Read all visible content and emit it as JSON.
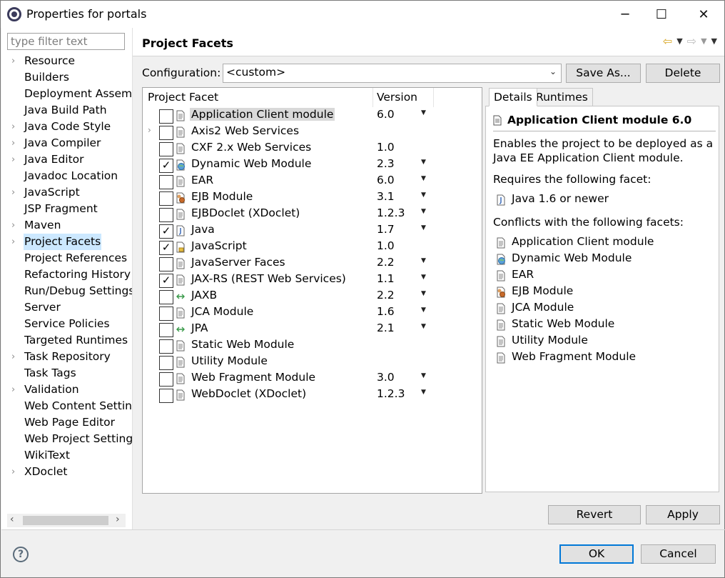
{
  "window": {
    "title": "Properties for portals",
    "minimize": "─",
    "maximize": "☐",
    "close": "✕"
  },
  "sidebar": {
    "filter_placeholder": "type filter text",
    "items": [
      {
        "label": "Resource",
        "expandable": true
      },
      {
        "label": "Builders",
        "expandable": false
      },
      {
        "label": "Deployment Assem",
        "expandable": false
      },
      {
        "label": "Java Build Path",
        "expandable": false
      },
      {
        "label": "Java Code Style",
        "expandable": true
      },
      {
        "label": "Java Compiler",
        "expandable": true
      },
      {
        "label": "Java Editor",
        "expandable": true
      },
      {
        "label": "Javadoc Location",
        "expandable": false
      },
      {
        "label": "JavaScript",
        "expandable": true
      },
      {
        "label": "JSP Fragment",
        "expandable": false
      },
      {
        "label": "Maven",
        "expandable": true
      },
      {
        "label": "Project Facets",
        "expandable": true,
        "selected": true
      },
      {
        "label": "Project References",
        "expandable": false
      },
      {
        "label": "Refactoring History",
        "expandable": false
      },
      {
        "label": "Run/Debug Settings",
        "expandable": false
      },
      {
        "label": "Server",
        "expandable": false
      },
      {
        "label": "Service Policies",
        "expandable": false
      },
      {
        "label": "Targeted Runtimes",
        "expandable": false
      },
      {
        "label": "Task Repository",
        "expandable": true
      },
      {
        "label": "Task Tags",
        "expandable": false
      },
      {
        "label": "Validation",
        "expandable": true
      },
      {
        "label": "Web Content Settin",
        "expandable": false
      },
      {
        "label": "Web Page Editor",
        "expandable": false
      },
      {
        "label": "Web Project Setting",
        "expandable": false
      },
      {
        "label": "WikiText",
        "expandable": false
      },
      {
        "label": "XDoclet",
        "expandable": true
      }
    ]
  },
  "header": {
    "title": "Project Facets"
  },
  "configuration": {
    "label": "Configuration:",
    "value": "<custom>",
    "save_as": "Save As...",
    "delete": "Delete"
  },
  "facets": {
    "col_facet": "Project Facet",
    "col_version": "Version",
    "rows": [
      {
        "name": "Application Client module",
        "version": "6.0",
        "checked": false,
        "dropdown": true,
        "highlight": true,
        "icon": "doc"
      },
      {
        "name": "Axis2 Web Services",
        "version": "",
        "checked": false,
        "dropdown": false,
        "expandable": true,
        "icon": "doc"
      },
      {
        "name": "CXF 2.x Web Services",
        "version": "1.0",
        "checked": false,
        "dropdown": false,
        "icon": "doc"
      },
      {
        "name": "Dynamic Web Module",
        "version": "2.3",
        "checked": true,
        "dropdown": true,
        "icon": "globe"
      },
      {
        "name": "EAR",
        "version": "6.0",
        "checked": false,
        "dropdown": true,
        "icon": "doc"
      },
      {
        "name": "EJB Module",
        "version": "3.1",
        "checked": false,
        "dropdown": true,
        "icon": "bean"
      },
      {
        "name": "EJBDoclet (XDoclet)",
        "version": "1.2.3",
        "checked": false,
        "dropdown": true,
        "icon": "doc"
      },
      {
        "name": "Java",
        "version": "1.7",
        "checked": true,
        "dropdown": true,
        "icon": "java"
      },
      {
        "name": "JavaScript",
        "version": "1.0",
        "checked": true,
        "dropdown": false,
        "icon": "js"
      },
      {
        "name": "JavaServer Faces",
        "version": "2.2",
        "checked": false,
        "dropdown": true,
        "icon": "doc"
      },
      {
        "name": "JAX-RS (REST Web Services)",
        "version": "1.1",
        "checked": true,
        "dropdown": true,
        "icon": "doc"
      },
      {
        "name": "JAXB",
        "version": "2.2",
        "checked": false,
        "dropdown": true,
        "icon": "arrows"
      },
      {
        "name": "JCA Module",
        "version": "1.6",
        "checked": false,
        "dropdown": true,
        "icon": "doc"
      },
      {
        "name": "JPA",
        "version": "2.1",
        "checked": false,
        "dropdown": true,
        "icon": "arrows"
      },
      {
        "name": "Static Web Module",
        "version": "",
        "checked": false,
        "dropdown": false,
        "icon": "doc"
      },
      {
        "name": "Utility Module",
        "version": "",
        "checked": false,
        "dropdown": false,
        "icon": "doc"
      },
      {
        "name": "Web Fragment Module",
        "version": "3.0",
        "checked": false,
        "dropdown": true,
        "icon": "doc"
      },
      {
        "name": "WebDoclet (XDoclet)",
        "version": "1.2.3",
        "checked": false,
        "dropdown": true,
        "icon": "doc"
      }
    ]
  },
  "details": {
    "tab_details": "Details",
    "tab_runtimes": "Runtimes",
    "title": "Application Client module 6.0",
    "desc1": "Enables the project to be deployed as a",
    "desc2": "Java EE Application Client module.",
    "requires_label": "Requires the following facet:",
    "requires": [
      {
        "label": "Java 1.6 or newer",
        "icon": "java"
      }
    ],
    "conflicts_label": "Conflicts with the following facets:",
    "conflicts": [
      {
        "label": "Application Client module",
        "icon": "doc"
      },
      {
        "label": "Dynamic Web Module",
        "icon": "globe"
      },
      {
        "label": "EAR",
        "icon": "doc"
      },
      {
        "label": "EJB Module",
        "icon": "bean"
      },
      {
        "label": "JCA Module",
        "icon": "doc"
      },
      {
        "label": "Static Web Module",
        "icon": "doc"
      },
      {
        "label": "Utility Module",
        "icon": "doc"
      },
      {
        "label": "Web Fragment Module",
        "icon": "doc"
      }
    ]
  },
  "buttons": {
    "revert": "Revert",
    "apply": "Apply",
    "ok": "OK",
    "cancel": "Cancel",
    "help": "?"
  },
  "colors": {
    "selection": "#cce8ff",
    "accent": "#0078d7",
    "highlight_row": "#d9d9d9"
  }
}
